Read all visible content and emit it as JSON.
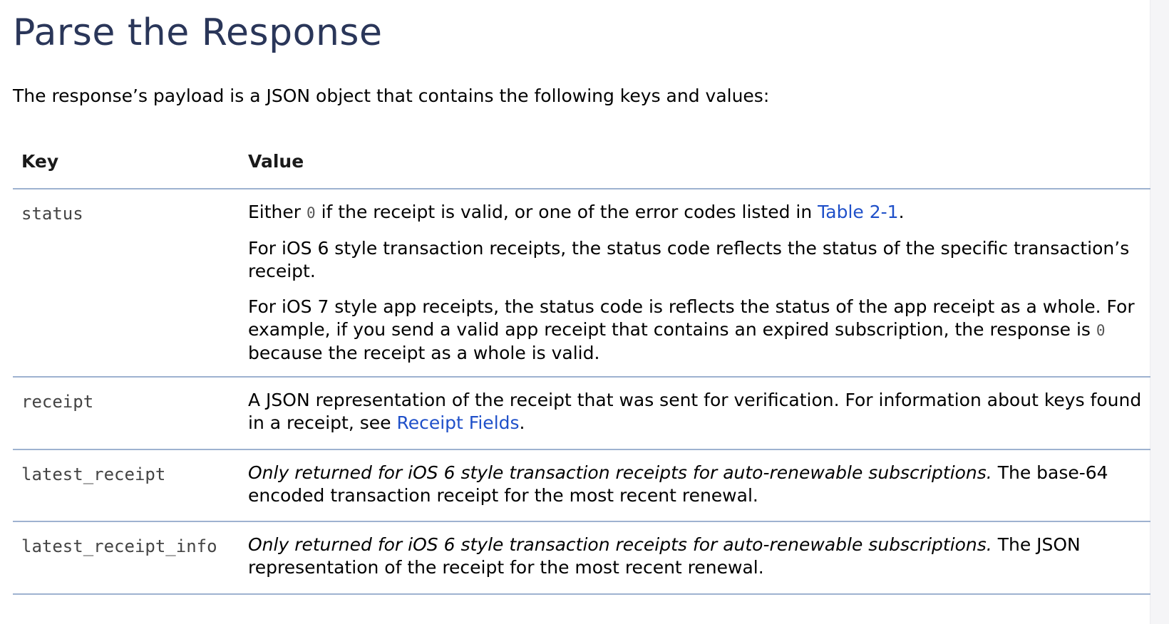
{
  "page": {
    "title": "Parse the Response",
    "intro": "The response’s payload is a JSON object that contains the following keys and values:"
  },
  "table": {
    "headers": {
      "key": "Key",
      "value": "Value"
    },
    "rows": [
      {
        "key": "status",
        "paragraphs": [
          {
            "pre": "Either ",
            "code": "0",
            "mid": " if the receipt is valid, or one of the error codes listed in ",
            "link": "Table 2-1",
            "post": "."
          },
          {
            "text": "For iOS 6 style transaction receipts, the status code reflects the status of the specific transaction’s receipt."
          },
          {
            "pre": "For iOS 7 style app receipts, the status code is reflects the status of the app receipt as a whole. For example, if you send a valid app receipt that contains an expired subscription, the response is ",
            "code": "0",
            "post": " because the receipt as a whole is valid."
          }
        ]
      },
      {
        "key": "receipt",
        "pre": "A JSON representation of the receipt that was sent for verification. For information about keys found in a receipt, see ",
        "link": "Receipt Fields",
        "post": "."
      },
      {
        "key": "latest_receipt",
        "italic": "Only returned for iOS 6 style transaction receipts for auto-renewable subscriptions.",
        "text": " The base-64 encoded transaction receipt for the most recent renewal."
      },
      {
        "key": "latest_receipt_info",
        "italic": "Only returned for iOS 6 style transaction receipts for auto-renewable subscriptions.",
        "text": " The JSON representation of the receipt for the most recent renewal."
      }
    ]
  },
  "colors": {
    "title": "#2a3659",
    "link": "#1f50c9",
    "rule": "#9eb2d0"
  }
}
